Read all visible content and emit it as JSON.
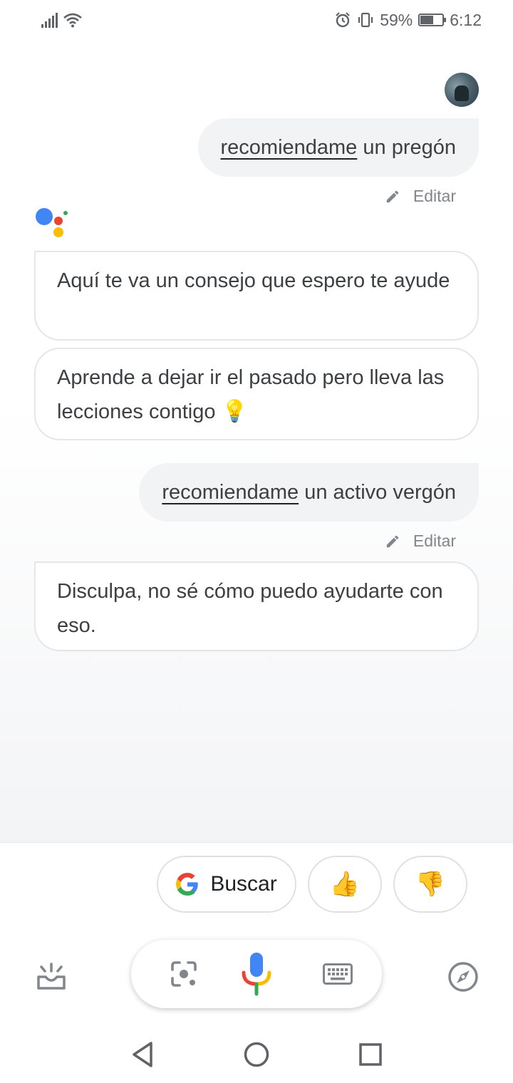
{
  "status_bar": {
    "battery_percent": "59%",
    "time": "6:12"
  },
  "conversation": [
    {
      "role": "user",
      "underlined": "recomiendame",
      "rest": " un pregón",
      "edit_label": "Editar"
    },
    {
      "role": "assistant",
      "text": "Aquí te va un consejo que espero te ayude"
    },
    {
      "role": "assistant",
      "text": "Aprende a dejar ir el pasado pero lleva las lecciones contigo",
      "emoji": "💡"
    },
    {
      "role": "user",
      "underlined": "recomiendame",
      "rest": " un activo vergón",
      "edit_label": "Editar"
    },
    {
      "role": "assistant",
      "text": "Disculpa, no sé cómo puedo ayudarte con eso."
    }
  ],
  "suggestions": {
    "search_label": "Buscar",
    "thumbs_up": "👍",
    "thumbs_down": "👎"
  },
  "colors": {
    "google_blue": "#4285F4",
    "google_red": "#EA4335",
    "google_yellow": "#FBBC05",
    "google_green": "#34A853",
    "icon_gray": "#80868b"
  },
  "icons": [
    "signal-icon",
    "wifi-icon",
    "alarm-icon",
    "vibrate-icon",
    "battery-icon",
    "edit-icon",
    "assistant-logo-icon",
    "google-g-icon",
    "snapshot-icon",
    "lens-icon",
    "mic-icon",
    "keyboard-icon",
    "compass-icon",
    "back-icon",
    "home-icon",
    "recents-icon"
  ]
}
